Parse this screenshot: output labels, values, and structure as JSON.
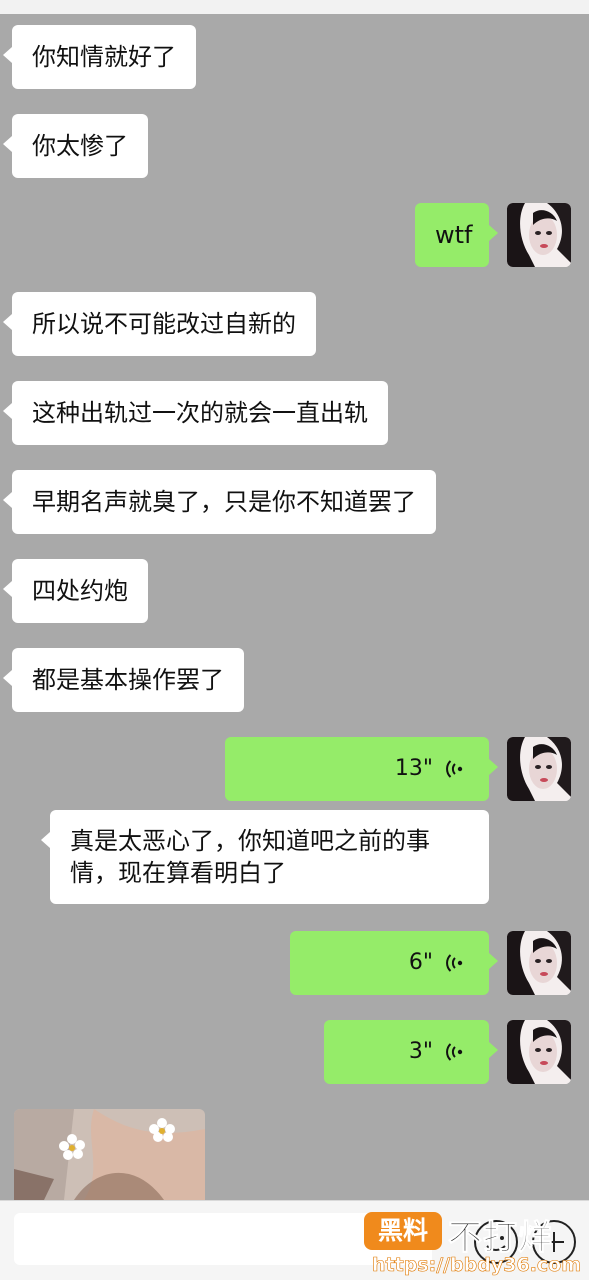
{
  "messages": [
    {
      "side": "in",
      "text": "你知情就好了"
    },
    {
      "side": "in",
      "text": "你太惨了"
    },
    {
      "side": "out",
      "text": "wtf"
    },
    {
      "side": "in",
      "text": "所以说不可能改过自新的"
    },
    {
      "side": "in",
      "text": "这种出轨过一次的就会一直出轨"
    },
    {
      "side": "in",
      "text": "早期名声就臭了，只是你不知道罢了"
    },
    {
      "side": "in",
      "text": "四处约炮"
    },
    {
      "side": "in",
      "text": "都是基本操作罢了"
    },
    {
      "side": "out",
      "type": "voice",
      "duration": "13\""
    },
    {
      "side": "in",
      "text": "真是太恶心了，你知道吧之前的事情，现在算看明白了"
    },
    {
      "side": "out",
      "type": "voice",
      "duration": "6\""
    },
    {
      "side": "out",
      "type": "voice",
      "duration": "3\""
    },
    {
      "side": "in",
      "type": "image",
      "icon": "flower-photo"
    }
  ],
  "input_bar": {
    "icons": [
      "emoji-icon",
      "plus-icon"
    ]
  },
  "watermark": {
    "badge": "黑料",
    "title": "不打烊",
    "url": "https://bbdy36.com"
  },
  "colors": {
    "chat_bg": "#a9a9a9",
    "incoming_bubble": "#ffffff",
    "outgoing_bubble": "#95ec69",
    "watermark_orange": "#f08a1c"
  }
}
